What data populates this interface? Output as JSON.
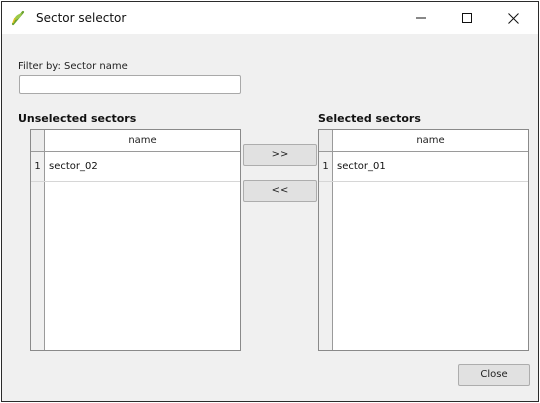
{
  "window": {
    "title": "Sector selector",
    "controls": {
      "minimize_icon": "minimize-icon",
      "maximize_icon": "maximize-icon",
      "close_icon": "close-icon"
    },
    "app_icon": "qgis-icon"
  },
  "filter": {
    "label": "Filter by: Sector name",
    "value": "",
    "placeholder": ""
  },
  "unselected": {
    "title": "Unselected sectors",
    "column": "name",
    "rows": [
      {
        "num": "1",
        "name": "sector_02"
      }
    ]
  },
  "selected": {
    "title": "Selected sectors",
    "column": "name",
    "rows": [
      {
        "num": "1",
        "name": "sector_01"
      }
    ]
  },
  "buttons": {
    "add": ">>",
    "remove": "<<",
    "close": "Close"
  },
  "colors": {
    "background": "#f0f0f0",
    "titlebar": "#ffffff",
    "button": "#e1e1e1",
    "icon_green": "#7fb33a"
  }
}
